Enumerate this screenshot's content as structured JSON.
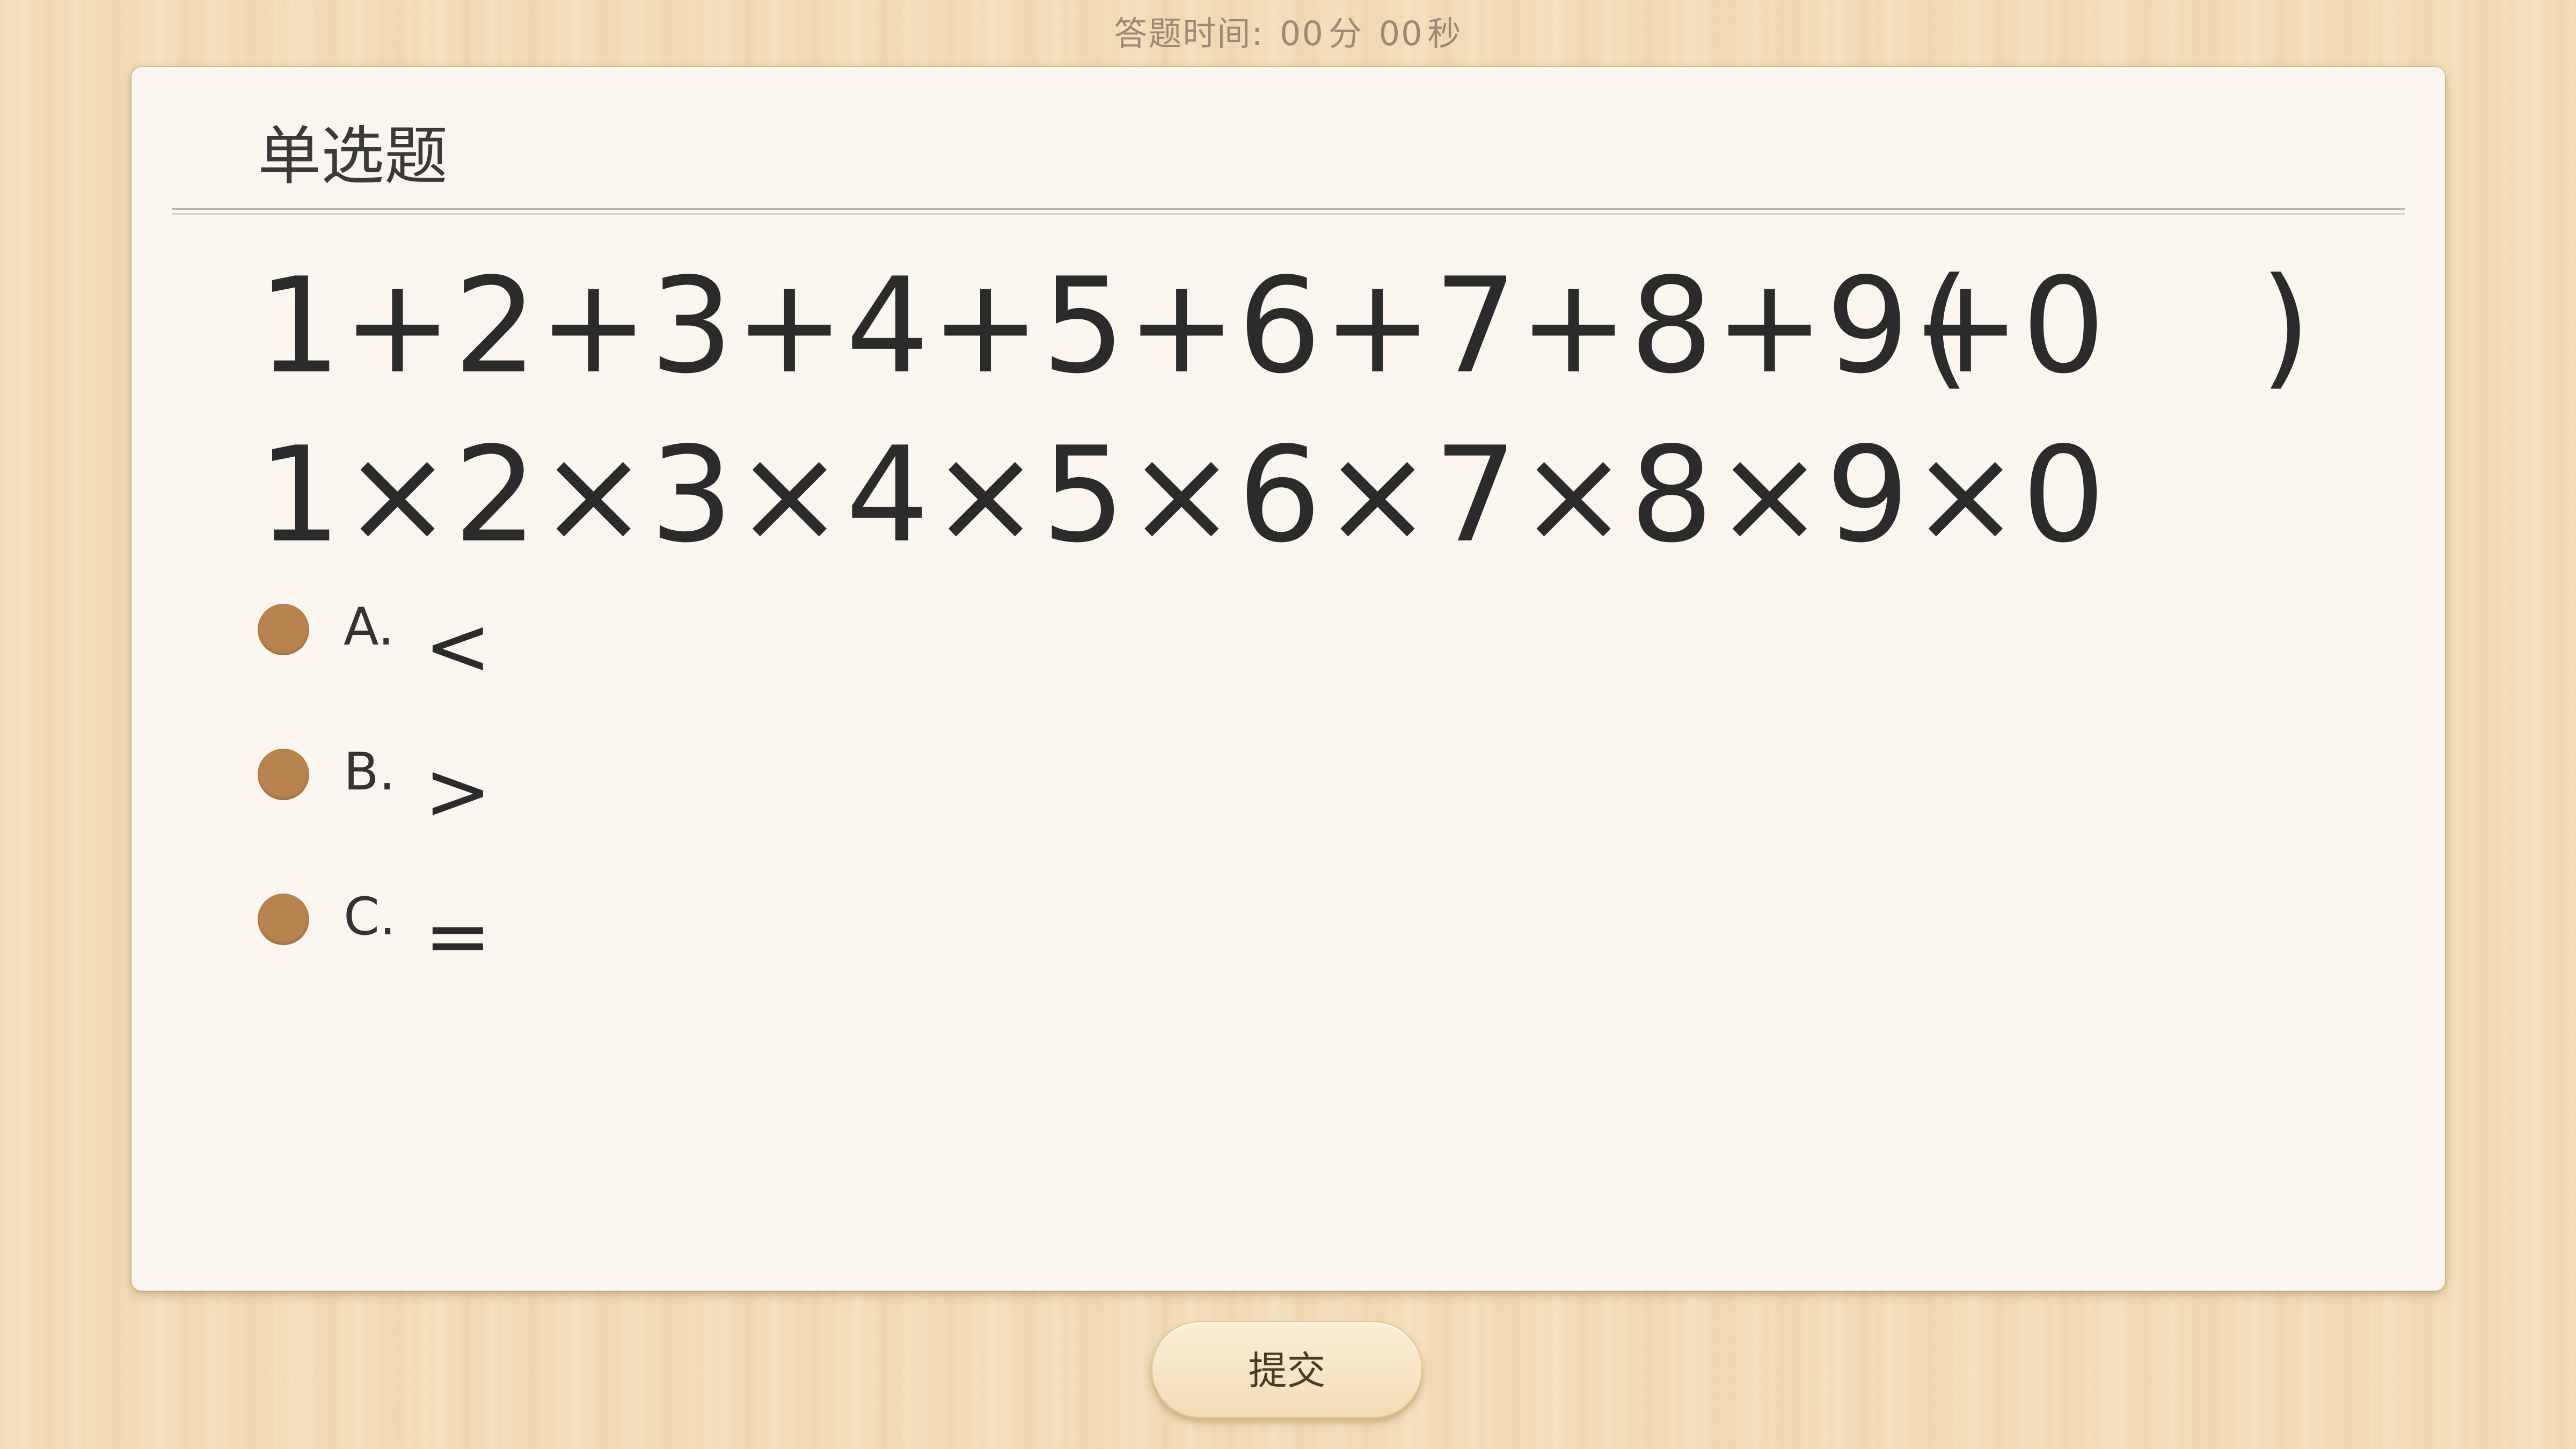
{
  "timer": {
    "label": "答题时间:",
    "minutes": "00",
    "minutes_unit": "分",
    "seconds": "00",
    "seconds_unit": "秒"
  },
  "question": {
    "type": "单选题",
    "line1": "1+2+3+4+5+6+7+8+9+0",
    "paren_open": "(",
    "paren_close": ")",
    "line2": "1×2×3×4×5×6×7×8×9×0"
  },
  "options": [
    {
      "letter": "A.",
      "text": "<"
    },
    {
      "letter": "B.",
      "text": ">"
    },
    {
      "letter": "C.",
      "text": "="
    }
  ],
  "submit_label": "提交",
  "colors": {
    "background": "#f3ddb8",
    "card": "#faf6ef",
    "radio": "#b98350"
  }
}
